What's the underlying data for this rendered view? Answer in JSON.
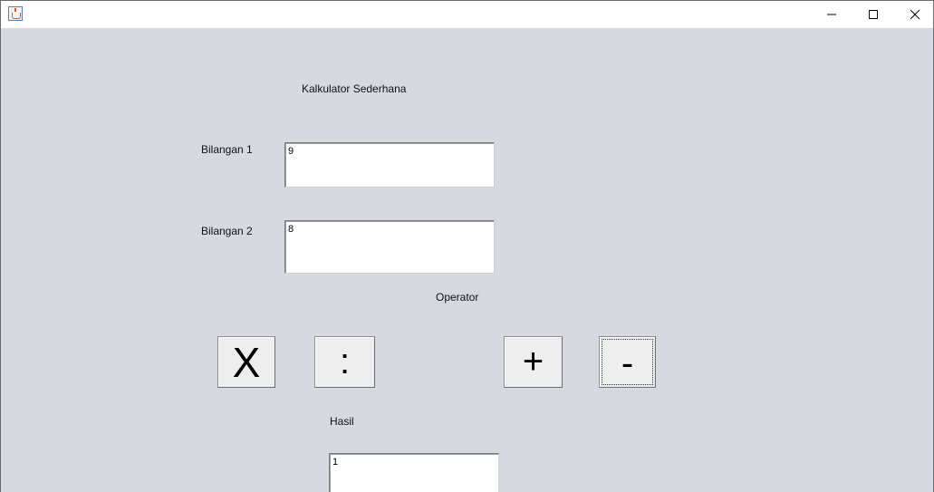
{
  "window": {
    "title": "",
    "icon": "java-cup-icon"
  },
  "titlebar_controls": {
    "minimize_icon": "minimize-icon",
    "maximize_icon": "maximize-icon",
    "close_icon": "close-icon"
  },
  "form": {
    "heading": "Kalkulator Sederhana",
    "number1_label": "Bilangan 1",
    "number1_value": "9",
    "number2_label": "Bilangan 2",
    "number2_value": "8",
    "operator_label": "Operator",
    "result_label": "Hasil",
    "result_value": "1"
  },
  "operators": {
    "multiply": "X",
    "divide": ":",
    "add": "+",
    "subtract": "-"
  },
  "colors": {
    "panel_background": "#d6d9e0",
    "button_face": "#eeeeee"
  }
}
